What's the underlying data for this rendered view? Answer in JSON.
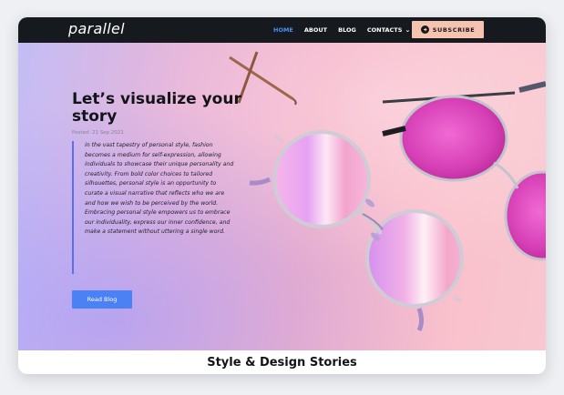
{
  "nav": {
    "logo": "parallel",
    "links": [
      "HOME",
      "ABOUT",
      "BLOG",
      "CONTACTS"
    ],
    "active": "HOME",
    "subscribe_label": "SUBSCRIBE",
    "subscribe_icon": "arrow-right-icon"
  },
  "hero": {
    "title": "Let’s visualize your story",
    "posted": "Posted: 21 Sep 2021",
    "quote": "in the vast tapestry of personal style, fashion becomes a medium for self-expression, allowing individuals to showcase their unique personality and creativity. From bold color choices to tailored silhouettes, personal style is an opportunity to curate a visual narrative that reflects who we are and how we wish to be perceived by the world. Embracing personal style empowers us to embrace our individuality, express our inner confidence, and make a statement without uttering a single word.",
    "button_label": "Read Blog"
  },
  "section": {
    "title": "Style & Design Stories"
  },
  "colors": {
    "nav_bg": "#16191d",
    "active_link": "#4a8ef5",
    "subscribe_bg": "#f6c3b0",
    "button_bg": "#4a82f5",
    "quote_bar": "#5a6ef0"
  }
}
